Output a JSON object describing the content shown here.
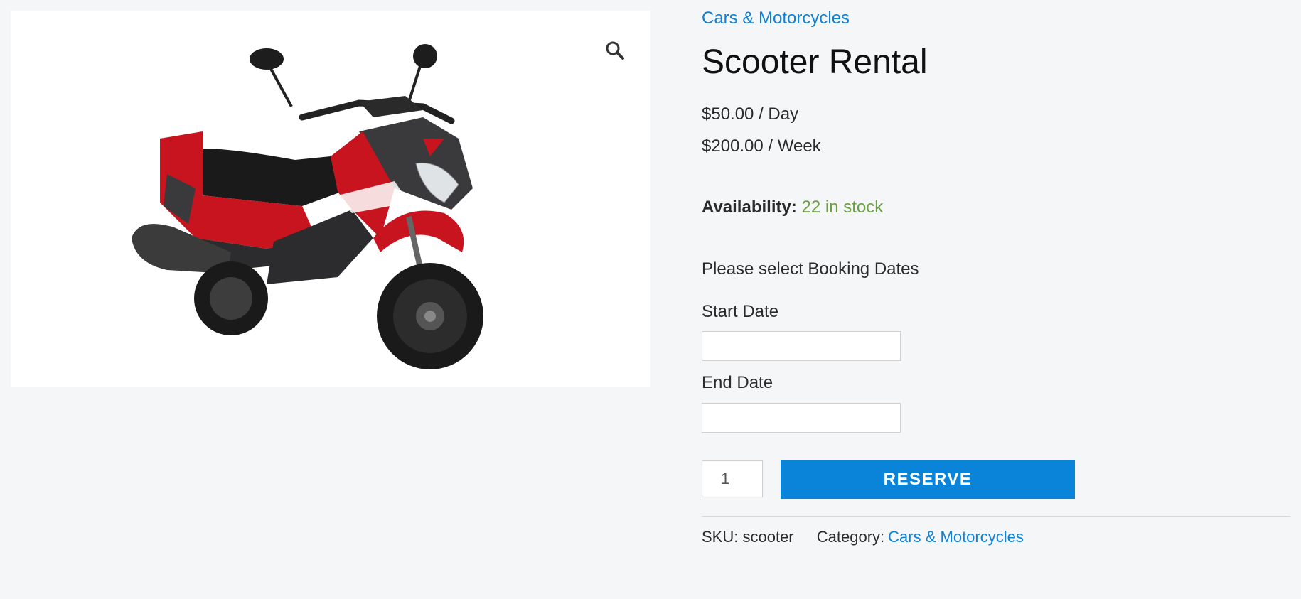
{
  "product": {
    "category_link": "Cars & Motorcycles",
    "title": "Scooter Rental",
    "prices": [
      "$50.00 / Day",
      "$200.00 / Week"
    ],
    "availability_label": "Availability:",
    "availability_value": "22 in stock",
    "booking_prompt": "Please select Booking Dates",
    "start_date_label": "Start Date",
    "start_date_value": "",
    "end_date_label": "End Date",
    "end_date_value": "",
    "quantity": "1",
    "reserve_label": "RESERVE",
    "sku_label": "SKU:",
    "sku_value": "scooter",
    "category_label": "Category:",
    "category_value": "Cars & Motorcycles"
  },
  "icons": {
    "zoom": "magnifier-icon"
  },
  "colors": {
    "link": "#0e82d6",
    "in_stock": "#6ba043",
    "button": "#0a84d8",
    "page_bg": "#f5f6f8",
    "scooter_body": "#c8141f"
  }
}
